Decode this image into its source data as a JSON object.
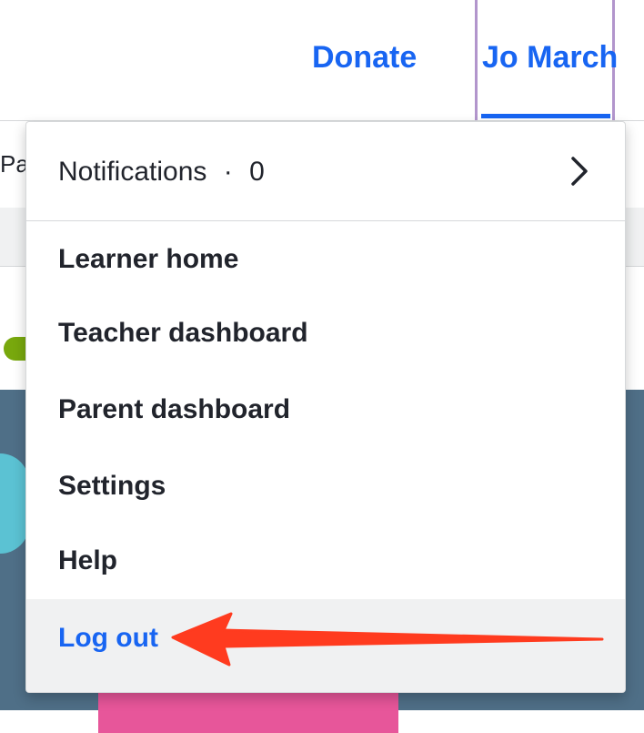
{
  "header": {
    "donate_label": "Donate",
    "user_name": "Jo March"
  },
  "background": {
    "tab_text": "Pa"
  },
  "dropdown": {
    "notifications": {
      "label": "Notifications",
      "separator": "·",
      "count": "0"
    },
    "items": [
      {
        "label": "Learner home"
      },
      {
        "label": "Teacher dashboard"
      },
      {
        "label": "Parent dashboard"
      },
      {
        "label": "Settings"
      },
      {
        "label": "Help"
      }
    ],
    "logout_label": "Log out"
  },
  "colors": {
    "link": "#1865f2",
    "text": "#21242c",
    "annotation_arrow": "#ff3b1f",
    "focus_outline": "#b295cc"
  }
}
